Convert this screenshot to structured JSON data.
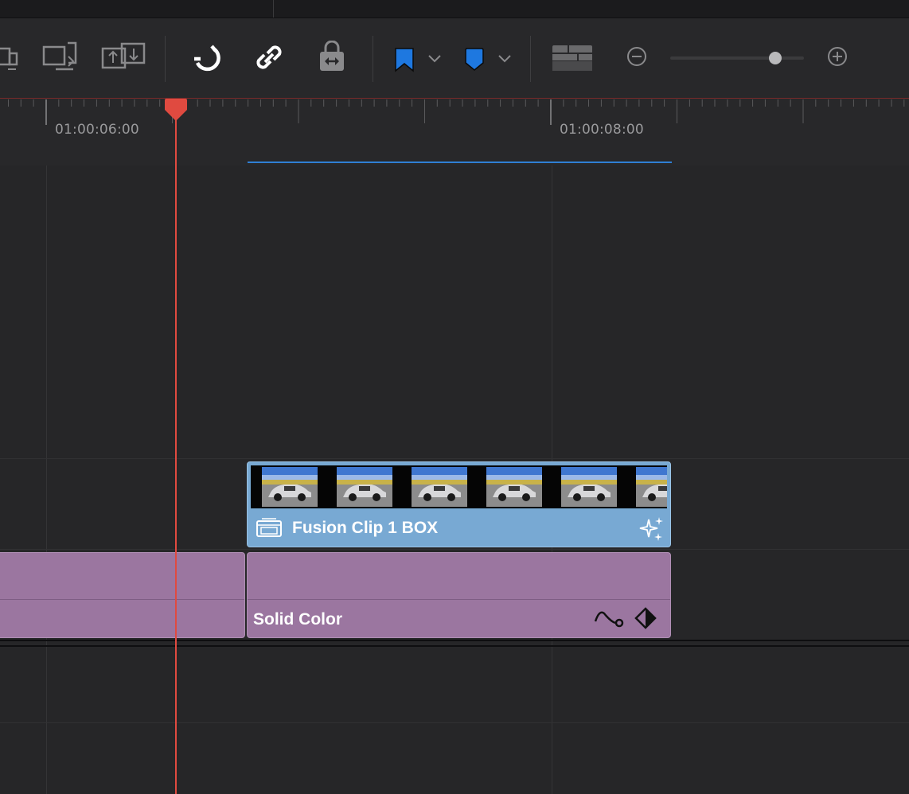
{
  "toolbar": {
    "icons": [
      "trim-mode-icon",
      "dynamic-trim-icon",
      "blade-icon",
      "snapping-icon",
      "linked-selection-icon",
      "position-lock-icon",
      "flag-icon",
      "flag-dropdown-icon",
      "marker-icon",
      "marker-dropdown-icon",
      "timeline-view-options-icon",
      "zoom-out-icon",
      "zoom-slider",
      "zoom-in-icon"
    ],
    "flag_color": "#1e78e0",
    "marker_color": "#1e78e0",
    "zoom_level": 0.78
  },
  "ruler": {
    "timecodes": [
      "01:00:06:00",
      "01:00:08:00"
    ],
    "range_color": "#2f7fd4",
    "playhead_color": "#e04a40"
  },
  "tracks": {
    "video_clip": {
      "label": "Fusion Clip 1 BOX",
      "color": "#78a9d3",
      "thumbnail_count": 6
    },
    "solid_clip": {
      "label": "Solid Color",
      "color": "#9b76a0"
    }
  }
}
